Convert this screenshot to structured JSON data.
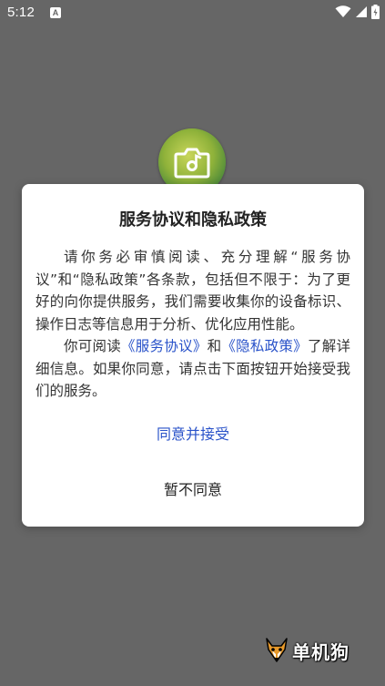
{
  "status_bar": {
    "time": "5:12",
    "notification_glyph": "A",
    "icons": [
      "wifi-icon",
      "signal-icon",
      "battery-icon"
    ]
  },
  "app": {
    "logo_icon": "camera-music-icon"
  },
  "dialog": {
    "title": "服务协议和隐私政策",
    "paragraph1": "请你务必审慎阅读、充分理解“服务协议”和“隐私政策”各条款，包括但不限于：为了更好的向你提供服务，我们需要收集你的设备标识、操作日志等信息用于分析、优化应用性能。",
    "paragraph2_prefix": "你可阅读",
    "service_link": "《服务协议》",
    "paragraph2_and": "和",
    "privacy_link": "《隐私政策》",
    "paragraph2_suffix": "了解详细信息。如果你同意，请点击下面按钮开始接受我们的服务。",
    "agree_button": "同意并接受",
    "disagree_button": "暂不同意",
    "link_color": "#2952c9"
  },
  "watermark": {
    "text": "单机狗",
    "icon": "dog-mascot-icon"
  }
}
